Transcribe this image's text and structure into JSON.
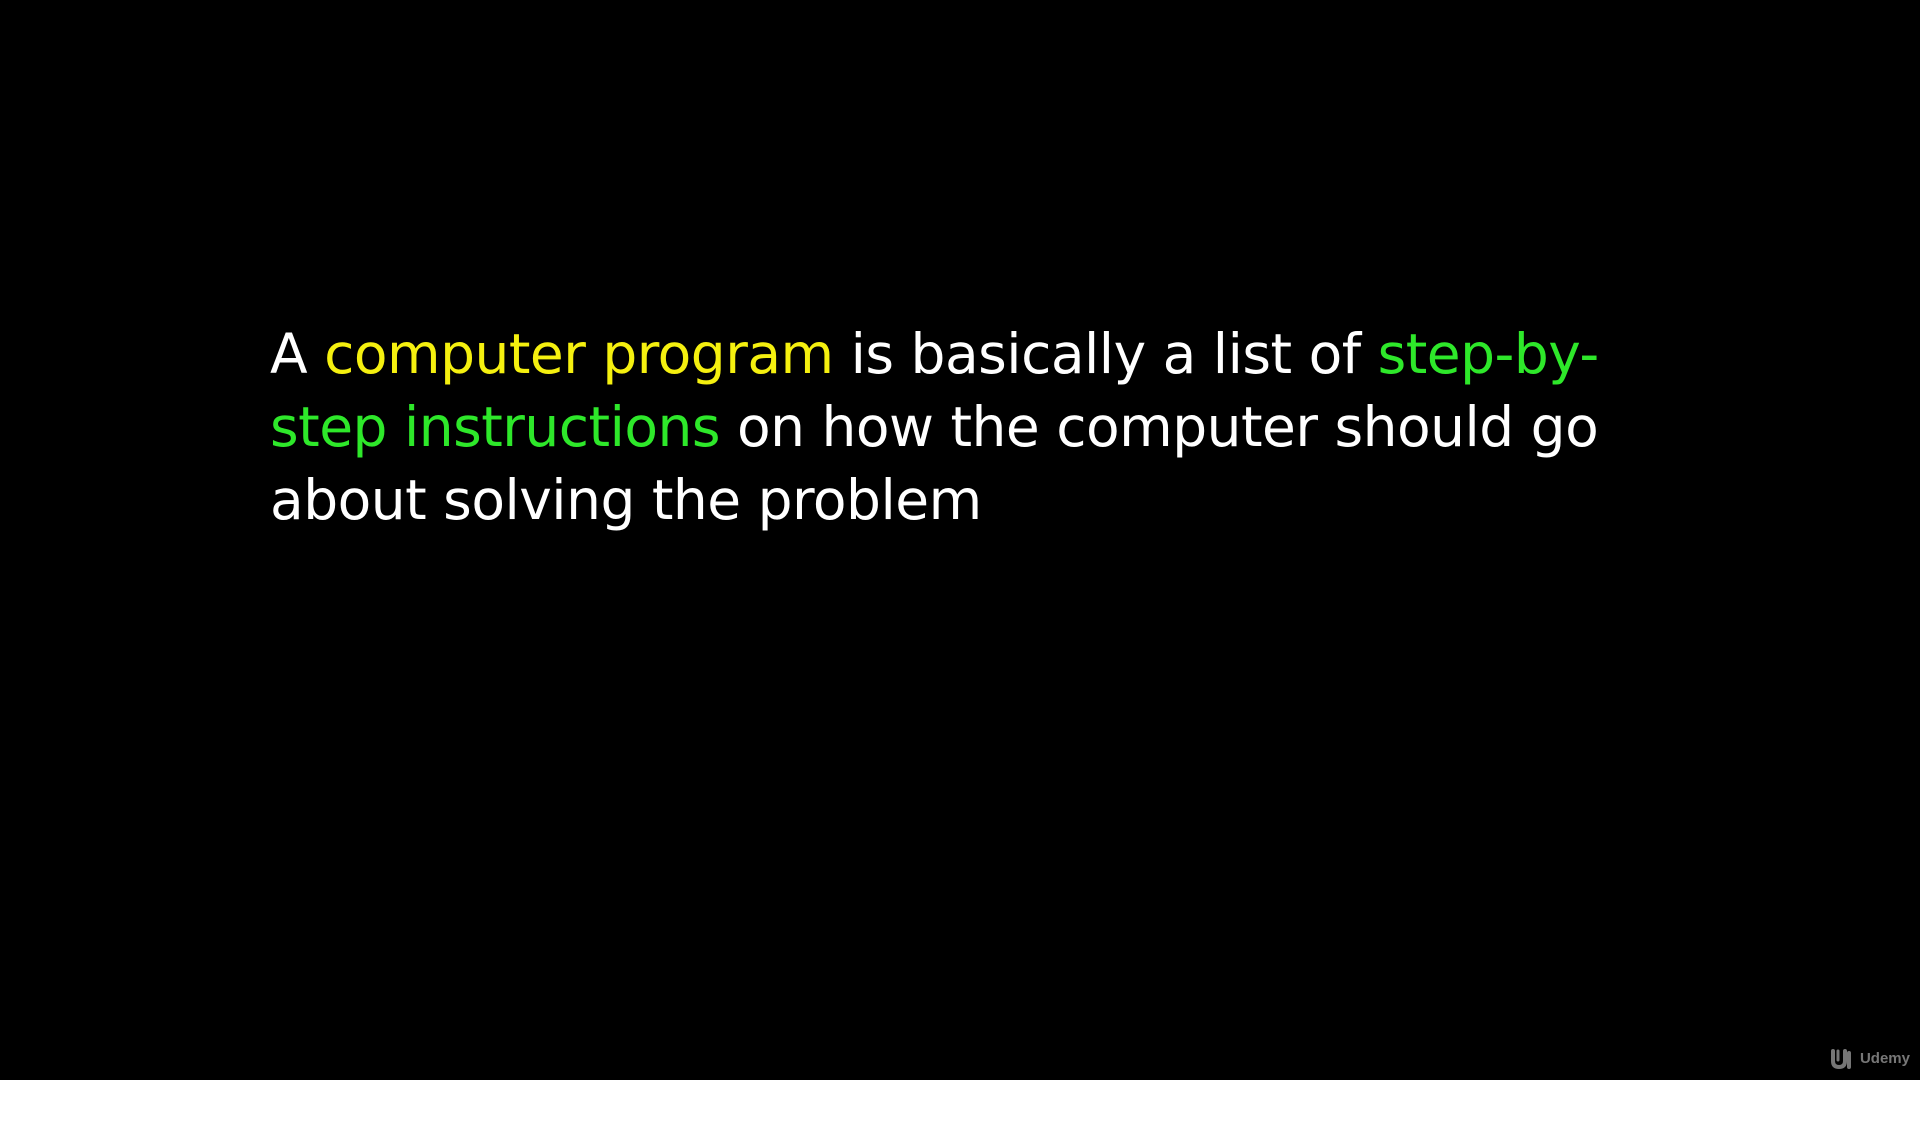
{
  "slide": {
    "segments": [
      {
        "text": "A ",
        "style": "plain"
      },
      {
        "text": "computer program",
        "style": "yellow"
      },
      {
        "text": " is basically a list of ",
        "style": "plain"
      },
      {
        "text": "step-by-step instructions",
        "style": "green"
      },
      {
        "text": " on how the computer should go about solving the problem",
        "style": "plain"
      }
    ],
    "colors": {
      "background": "#000000",
      "text": "#ffffff",
      "highlight_yellow": "#f5f00f",
      "highlight_green": "#2ee82a"
    }
  },
  "watermark": {
    "label": "Udemy",
    "icon": "udemy-logo-icon"
  }
}
